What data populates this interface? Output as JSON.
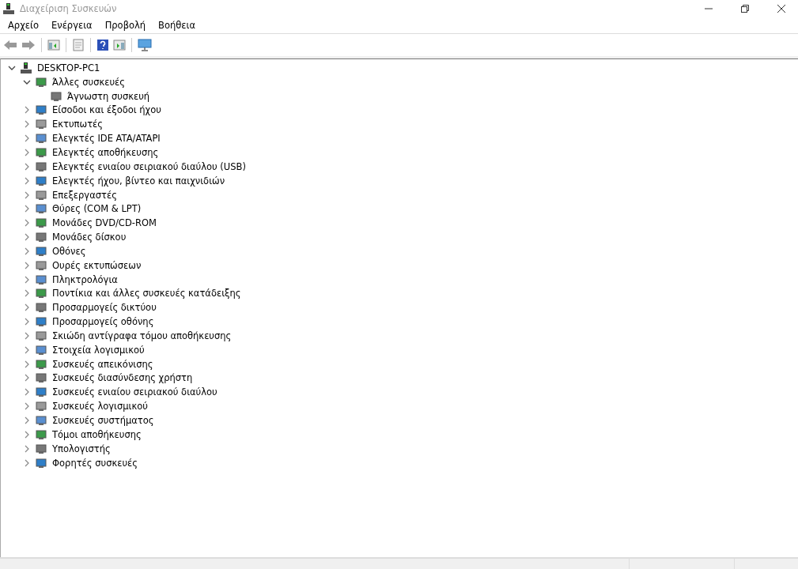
{
  "window": {
    "title": "Διαχείριση Συσκευών"
  },
  "menu": [
    "Αρχείο",
    "Ενέργεια",
    "Προβολή",
    "Βοήθεια"
  ],
  "tree": [
    {
      "label": "DESKTOP-PC1",
      "expanded": true,
      "children": [
        {
          "label": "Άλλες συσκευές",
          "expanded": true,
          "children": [
            {
              "label": "Άγνωστη συσκευή"
            }
          ]
        },
        {
          "label": "Είσοδοι και έξοδοι ήχου",
          "expanded": false
        },
        {
          "label": "Εκτυπωτές",
          "expanded": false
        },
        {
          "label": "Ελεγκτές IDE ATA/ATAPI",
          "expanded": false
        },
        {
          "label": "Ελεγκτές αποθήκευσης",
          "expanded": false
        },
        {
          "label": "Ελεγκτές ενιαίου σειριακού διαύλου (USB)",
          "expanded": false
        },
        {
          "label": "Ελεγκτές ήχου, βίντεο και παιχνιδιών",
          "expanded": false
        },
        {
          "label": "Επεξεργαστές",
          "expanded": false
        },
        {
          "label": "Θύρες (COM & LPT)",
          "expanded": false
        },
        {
          "label": "Μονάδες DVD/CD-ROM",
          "expanded": false
        },
        {
          "label": "Μονάδες δίσκου",
          "expanded": false
        },
        {
          "label": "Οθόνες",
          "expanded": false
        },
        {
          "label": "Ουρές εκτυπώσεων",
          "expanded": false
        },
        {
          "label": "Πληκτρολόγια",
          "expanded": false
        },
        {
          "label": "Ποντίκια και άλλες συσκευές κατάδειξης",
          "expanded": false
        },
        {
          "label": "Προσαρμογείς δικτύου",
          "expanded": false
        },
        {
          "label": "Προσαρμογείς οθόνης",
          "expanded": false
        },
        {
          "label": "Σκιώδη αντίγραφα τόμου αποθήκευσης",
          "expanded": false
        },
        {
          "label": "Στοιχεία λογισμικού",
          "expanded": false
        },
        {
          "label": "Συσκευές απεικόνισης",
          "expanded": false
        },
        {
          "label": "Συσκευές διασύνδεσης χρήστη",
          "expanded": false
        },
        {
          "label": "Συσκευές ενιαίου σειριακού διαύλου",
          "expanded": false
        },
        {
          "label": "Συσκευές λογισμικού",
          "expanded": false
        },
        {
          "label": "Συσκευές συστήματος",
          "expanded": false
        },
        {
          "label": "Τόμοι αποθήκευσης",
          "expanded": false
        },
        {
          "label": "Υπολογιστής",
          "expanded": false
        },
        {
          "label": "Φορητές συσκευές",
          "expanded": false
        }
      ]
    }
  ]
}
